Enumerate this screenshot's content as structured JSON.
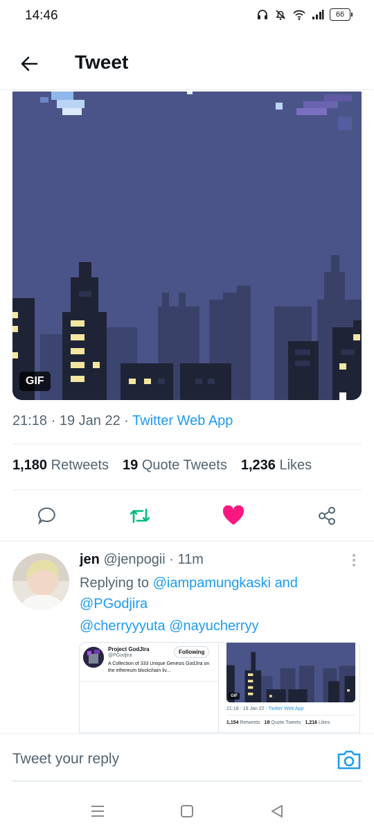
{
  "status_bar": {
    "time": "14:46",
    "battery": "66"
  },
  "header": {
    "title": "Tweet"
  },
  "media": {
    "badge": "GIF"
  },
  "tweet_meta": {
    "time": "21:18",
    "sep1": "·",
    "date": "19 Jan 22",
    "sep2": "·",
    "source": "Twitter Web App"
  },
  "stats": {
    "retweets_count": "1,180",
    "retweets_label": "Retweets",
    "quotes_count": "19",
    "quotes_label": "Quote Tweets",
    "likes_count": "1,236",
    "likes_label": "Likes"
  },
  "colors": {
    "accent": "#1d9bf0",
    "retweet": "#00ba7c",
    "like": "#f91880",
    "night_sky": "#4a5488"
  },
  "reply": {
    "name": "jen",
    "handle": "@jenpogii",
    "sep": "·",
    "time": "11m",
    "replying_to": "Replying to",
    "mention1": "@iampamungkaski",
    "and": "and",
    "mention2": "@PGodjira",
    "text_mentions": "@cherryyyuta @nayucherryy",
    "screenshot": {
      "profile_name": "Project GodJira",
      "profile_handle": "@PGodjira",
      "follow_label": "Following",
      "bio": "A Collection of 333 Unique Genesis GodJira on the ethereum blockchain liv...",
      "gif_badge": "GIF",
      "meta_time": "21:18 · 19 Jan 22 ·",
      "meta_source": "Twitter Web App",
      "retweets_count": "1,154",
      "retweets_label": "Retweets",
      "quotes_count": "18",
      "quotes_label": "Quote Tweets",
      "likes_count": "1,216",
      "likes_label": "Likes"
    }
  },
  "reply_bar": {
    "placeholder": "Tweet your reply"
  }
}
